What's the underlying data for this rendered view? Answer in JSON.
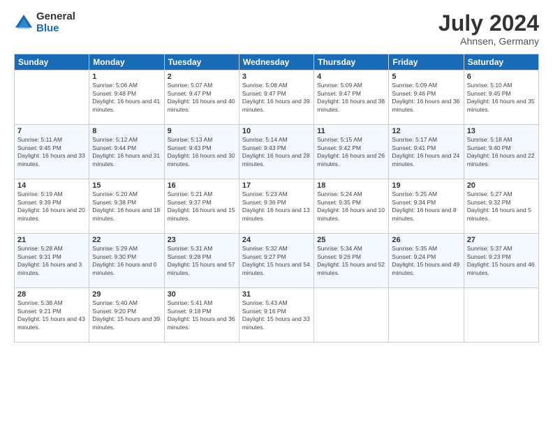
{
  "logo": {
    "general": "General",
    "blue": "Blue"
  },
  "title": {
    "month_year": "July 2024",
    "location": "Ahnsen, Germany"
  },
  "days_of_week": [
    "Sunday",
    "Monday",
    "Tuesday",
    "Wednesday",
    "Thursday",
    "Friday",
    "Saturday"
  ],
  "weeks": [
    [
      {
        "day": "",
        "sunrise": "",
        "sunset": "",
        "daylight": ""
      },
      {
        "day": "1",
        "sunrise": "Sunrise: 5:06 AM",
        "sunset": "Sunset: 9:48 PM",
        "daylight": "Daylight: 16 hours and 41 minutes."
      },
      {
        "day": "2",
        "sunrise": "Sunrise: 5:07 AM",
        "sunset": "Sunset: 9:47 PM",
        "daylight": "Daylight: 16 hours and 40 minutes."
      },
      {
        "day": "3",
        "sunrise": "Sunrise: 5:08 AM",
        "sunset": "Sunset: 9:47 PM",
        "daylight": "Daylight: 16 hours and 39 minutes."
      },
      {
        "day": "4",
        "sunrise": "Sunrise: 5:09 AM",
        "sunset": "Sunset: 9:47 PM",
        "daylight": "Daylight: 16 hours and 38 minutes."
      },
      {
        "day": "5",
        "sunrise": "Sunrise: 5:09 AM",
        "sunset": "Sunset: 9:46 PM",
        "daylight": "Daylight: 16 hours and 36 minutes."
      },
      {
        "day": "6",
        "sunrise": "Sunrise: 5:10 AM",
        "sunset": "Sunset: 9:45 PM",
        "daylight": "Daylight: 16 hours and 35 minutes."
      }
    ],
    [
      {
        "day": "7",
        "sunrise": "Sunrise: 5:11 AM",
        "sunset": "Sunset: 9:45 PM",
        "daylight": "Daylight: 16 hours and 33 minutes."
      },
      {
        "day": "8",
        "sunrise": "Sunrise: 5:12 AM",
        "sunset": "Sunset: 9:44 PM",
        "daylight": "Daylight: 16 hours and 31 minutes."
      },
      {
        "day": "9",
        "sunrise": "Sunrise: 5:13 AM",
        "sunset": "Sunset: 9:43 PM",
        "daylight": "Daylight: 16 hours and 30 minutes."
      },
      {
        "day": "10",
        "sunrise": "Sunrise: 5:14 AM",
        "sunset": "Sunset: 9:43 PM",
        "daylight": "Daylight: 16 hours and 28 minutes."
      },
      {
        "day": "11",
        "sunrise": "Sunrise: 5:15 AM",
        "sunset": "Sunset: 9:42 PM",
        "daylight": "Daylight: 16 hours and 26 minutes."
      },
      {
        "day": "12",
        "sunrise": "Sunrise: 5:17 AM",
        "sunset": "Sunset: 9:41 PM",
        "daylight": "Daylight: 16 hours and 24 minutes."
      },
      {
        "day": "13",
        "sunrise": "Sunrise: 5:18 AM",
        "sunset": "Sunset: 9:40 PM",
        "daylight": "Daylight: 16 hours and 22 minutes."
      }
    ],
    [
      {
        "day": "14",
        "sunrise": "Sunrise: 5:19 AM",
        "sunset": "Sunset: 9:39 PM",
        "daylight": "Daylight: 16 hours and 20 minutes."
      },
      {
        "day": "15",
        "sunrise": "Sunrise: 5:20 AM",
        "sunset": "Sunset: 9:38 PM",
        "daylight": "Daylight: 16 hours and 18 minutes."
      },
      {
        "day": "16",
        "sunrise": "Sunrise: 5:21 AM",
        "sunset": "Sunset: 9:37 PM",
        "daylight": "Daylight: 16 hours and 15 minutes."
      },
      {
        "day": "17",
        "sunrise": "Sunrise: 5:23 AM",
        "sunset": "Sunset: 9:36 PM",
        "daylight": "Daylight: 16 hours and 13 minutes."
      },
      {
        "day": "18",
        "sunrise": "Sunrise: 5:24 AM",
        "sunset": "Sunset: 9:35 PM",
        "daylight": "Daylight: 16 hours and 10 minutes."
      },
      {
        "day": "19",
        "sunrise": "Sunrise: 5:25 AM",
        "sunset": "Sunset: 9:34 PM",
        "daylight": "Daylight: 16 hours and 8 minutes."
      },
      {
        "day": "20",
        "sunrise": "Sunrise: 5:27 AM",
        "sunset": "Sunset: 9:32 PM",
        "daylight": "Daylight: 16 hours and 5 minutes."
      }
    ],
    [
      {
        "day": "21",
        "sunrise": "Sunrise: 5:28 AM",
        "sunset": "Sunset: 9:31 PM",
        "daylight": "Daylight: 16 hours and 3 minutes."
      },
      {
        "day": "22",
        "sunrise": "Sunrise: 5:29 AM",
        "sunset": "Sunset: 9:30 PM",
        "daylight": "Daylight: 16 hours and 0 minutes."
      },
      {
        "day": "23",
        "sunrise": "Sunrise: 5:31 AM",
        "sunset": "Sunset: 9:28 PM",
        "daylight": "Daylight: 15 hours and 57 minutes."
      },
      {
        "day": "24",
        "sunrise": "Sunrise: 5:32 AM",
        "sunset": "Sunset: 9:27 PM",
        "daylight": "Daylight: 15 hours and 54 minutes."
      },
      {
        "day": "25",
        "sunrise": "Sunrise: 5:34 AM",
        "sunset": "Sunset: 9:26 PM",
        "daylight": "Daylight: 15 hours and 52 minutes."
      },
      {
        "day": "26",
        "sunrise": "Sunrise: 5:35 AM",
        "sunset": "Sunset: 9:24 PM",
        "daylight": "Daylight: 15 hours and 49 minutes."
      },
      {
        "day": "27",
        "sunrise": "Sunrise: 5:37 AM",
        "sunset": "Sunset: 9:23 PM",
        "daylight": "Daylight: 15 hours and 46 minutes."
      }
    ],
    [
      {
        "day": "28",
        "sunrise": "Sunrise: 5:38 AM",
        "sunset": "Sunset: 9:21 PM",
        "daylight": "Daylight: 15 hours and 43 minutes."
      },
      {
        "day": "29",
        "sunrise": "Sunrise: 5:40 AM",
        "sunset": "Sunset: 9:20 PM",
        "daylight": "Daylight: 15 hours and 39 minutes."
      },
      {
        "day": "30",
        "sunrise": "Sunrise: 5:41 AM",
        "sunset": "Sunset: 9:18 PM",
        "daylight": "Daylight: 15 hours and 36 minutes."
      },
      {
        "day": "31",
        "sunrise": "Sunrise: 5:43 AM",
        "sunset": "Sunset: 9:16 PM",
        "daylight": "Daylight: 15 hours and 33 minutes."
      },
      {
        "day": "",
        "sunrise": "",
        "sunset": "",
        "daylight": ""
      },
      {
        "day": "",
        "sunrise": "",
        "sunset": "",
        "daylight": ""
      },
      {
        "day": "",
        "sunrise": "",
        "sunset": "",
        "daylight": ""
      }
    ]
  ]
}
